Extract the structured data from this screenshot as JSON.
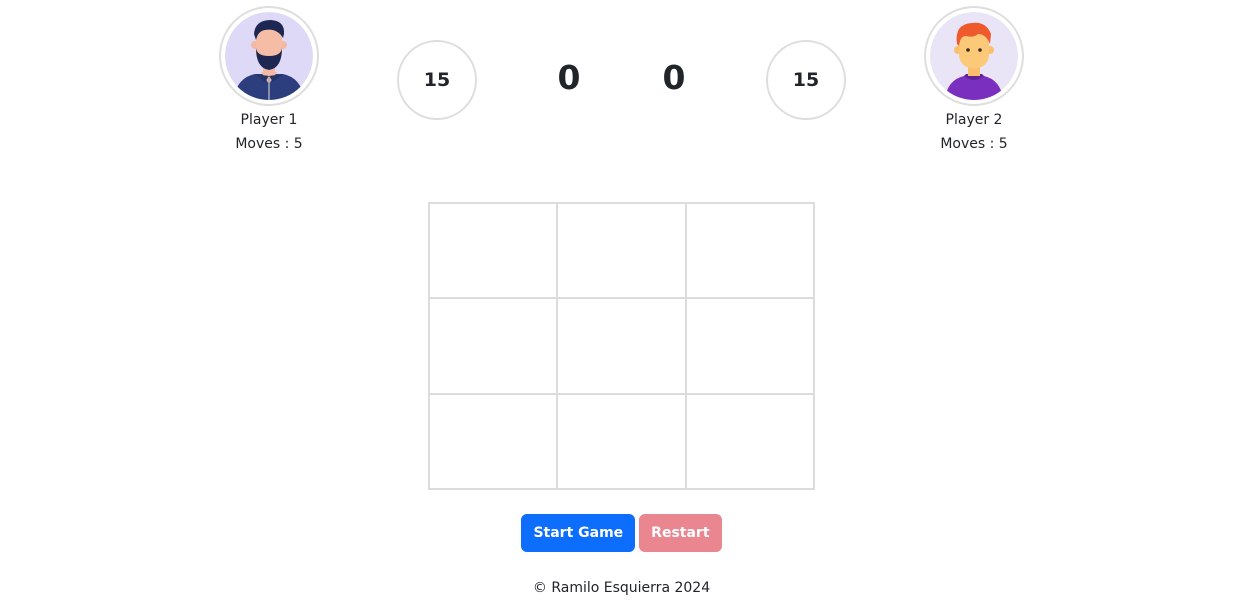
{
  "players": [
    {
      "name": "Player 1",
      "moves": "Moves : 5",
      "avatar": "bearded-man-avatar-icon",
      "avatar_bg": "#ddd9f7"
    },
    {
      "name": "Player 2",
      "moves": "Moves : 5",
      "avatar": "red-haired-boy-avatar-icon",
      "avatar_bg": "#e9e4f6"
    }
  ],
  "timers": [
    "15",
    "15"
  ],
  "scores": [
    "0",
    "0"
  ],
  "board": {
    "cells": [
      "",
      "",
      "",
      "",
      "",
      "",
      "",
      "",
      ""
    ]
  },
  "buttons": {
    "start_label": "Start Game",
    "restart_label": "Restart"
  },
  "footer": {
    "text": "© Ramilo Esquierra 2024"
  },
  "colors": {
    "start_button": "#0d6efd",
    "restart_button": "#ea868f",
    "border": "#dcdcdc",
    "text": "#212529"
  }
}
